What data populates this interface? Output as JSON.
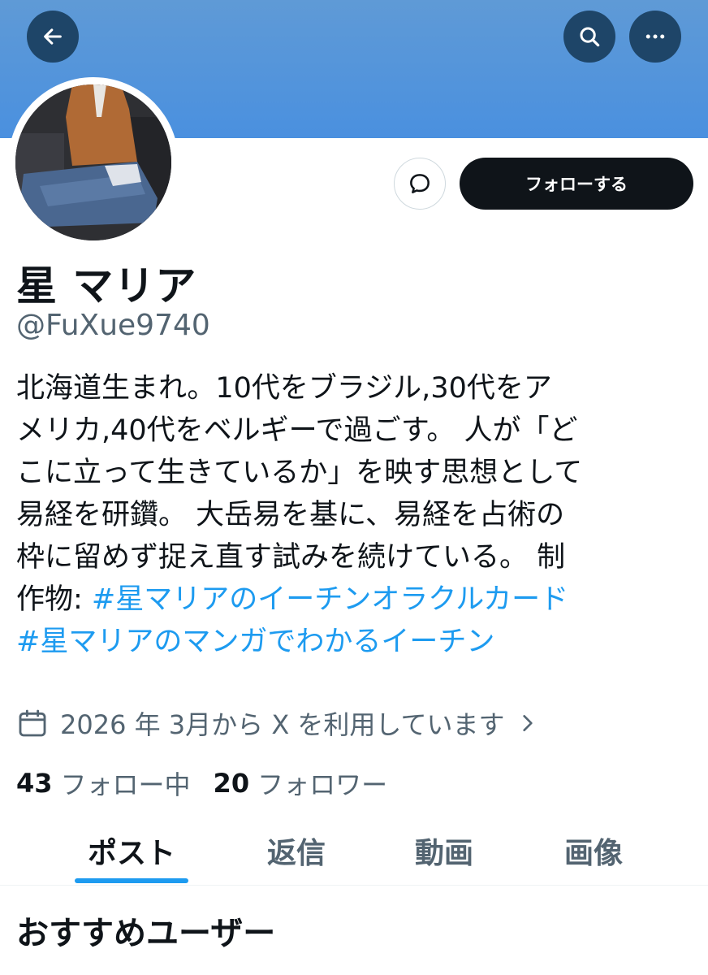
{
  "header": {
    "back_icon": "arrow-left-icon",
    "search_icon": "search-icon",
    "more_icon": "more-horizontal-icon"
  },
  "profile": {
    "display_name": "星 マリア",
    "handle": "@FuXue9740",
    "follow_label": "フォローする",
    "dm_icon": "message-bubble-icon",
    "bio": {
      "line1": "北海道生まれ。10代をブラジル,30代をア",
      "line2": "メリカ,40代をベルギーで過ごす。 人が「ど",
      "line3": "こに立って生きているか」を映す思想として",
      "line4": "易経を研鑽。 大岳易を基に、易経を占術の",
      "line5": "枠に留めず捉え直す試みを続けている。 制",
      "line6_prefix": "作物: ",
      "hashtag1": "#星マリアのイーチンオラクルカード",
      "hashtag2": "#星マリアのマンガでわかるイーチン"
    },
    "joined_text": "2026 年 3月から X を利用しています",
    "following_count": "43",
    "following_label": "フォロー中",
    "followers_count": "20",
    "followers_label": "フォロワー"
  },
  "tabs": [
    {
      "label": "ポスト",
      "active": true
    },
    {
      "label": "返信",
      "active": false
    },
    {
      "label": "動画",
      "active": false
    },
    {
      "label": "画像",
      "active": false
    }
  ],
  "recommend": {
    "title": "おすすめユーザー"
  },
  "colors": {
    "banner": "#4a90df",
    "accent": "#1d9bf0",
    "text_primary": "#0f1419",
    "text_secondary": "#536471",
    "header_button": "#1e4568"
  }
}
